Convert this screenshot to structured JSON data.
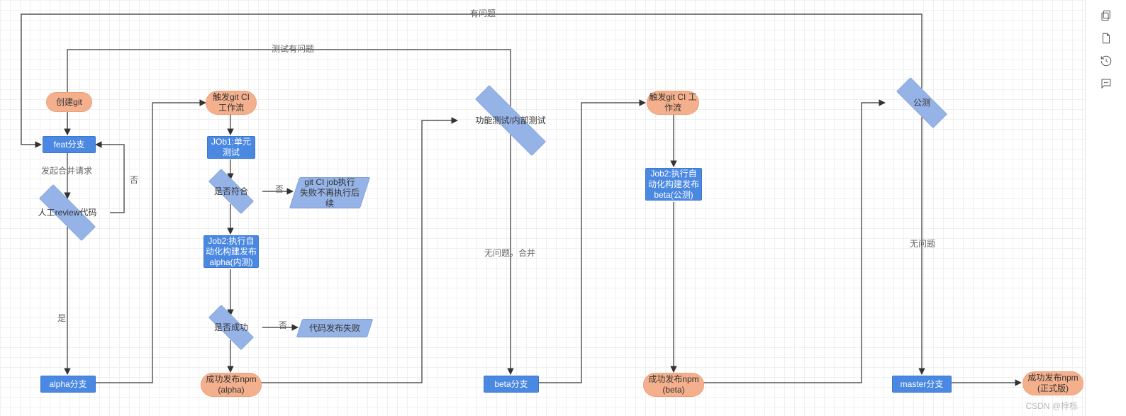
{
  "watermark": "CSDN @桲栎",
  "chart_data": {
    "type": "flowchart",
    "nodes": [
      {
        "id": "n1",
        "shape": "pill",
        "label": "创建git"
      },
      {
        "id": "n2",
        "shape": "rect",
        "label": "feat分支"
      },
      {
        "id": "n3",
        "shape": "diamond",
        "label": "人工review代码"
      },
      {
        "id": "n4",
        "shape": "rect",
        "label": "alpha分支"
      },
      {
        "id": "n5",
        "shape": "pill",
        "label": "触发git CI\n工作流"
      },
      {
        "id": "n6",
        "shape": "rect",
        "label": "JOb1:单元\n测试"
      },
      {
        "id": "n7",
        "shape": "diamond",
        "label": "是否符合"
      },
      {
        "id": "n8",
        "shape": "parallelogram",
        "label": "git CI job执行\n失败不再执行后\n续"
      },
      {
        "id": "n9",
        "shape": "rect",
        "label": "Job2:执行自\n动化构建发布\nalpha(内测)"
      },
      {
        "id": "n10",
        "shape": "diamond",
        "label": "是否成功"
      },
      {
        "id": "n11",
        "shape": "parallelogram",
        "label": "代码发布失败"
      },
      {
        "id": "n12",
        "shape": "pill",
        "label": "成功发布npm\n(alpha)"
      },
      {
        "id": "n13",
        "shape": "diamond",
        "label": "功能测试/内部测试"
      },
      {
        "id": "n14",
        "shape": "rect",
        "label": "beta分支"
      },
      {
        "id": "n15",
        "shape": "pill",
        "label": "触发git CI\n工作流"
      },
      {
        "id": "n16",
        "shape": "rect",
        "label": "Job2:执行自\n动化构建发布\nbeta(公测)"
      },
      {
        "id": "n17",
        "shape": "pill",
        "label": "成功发布npm\n(beta)"
      },
      {
        "id": "n18",
        "shape": "diamond",
        "label": "公测"
      },
      {
        "id": "n19",
        "shape": "rect",
        "label": "master分支"
      },
      {
        "id": "n20",
        "shape": "pill",
        "label": "成功发布npm\n(正式版)"
      }
    ],
    "edges": [
      {
        "from": "n1",
        "to": "n2"
      },
      {
        "from": "n2",
        "to": "n3",
        "label": "发起合并请求"
      },
      {
        "from": "n3",
        "to": "n4",
        "label": "是"
      },
      {
        "from": "n3",
        "to": "n2",
        "label": "否"
      },
      {
        "from": "n4",
        "to": "n5"
      },
      {
        "from": "n5",
        "to": "n6"
      },
      {
        "from": "n6",
        "to": "n7"
      },
      {
        "from": "n7",
        "to": "n8",
        "label": "否"
      },
      {
        "from": "n7",
        "to": "n9"
      },
      {
        "from": "n9",
        "to": "n10"
      },
      {
        "from": "n10",
        "to": "n11",
        "label": "否"
      },
      {
        "from": "n10",
        "to": "n12"
      },
      {
        "from": "n12",
        "to": "n13"
      },
      {
        "from": "n13",
        "to": "n14",
        "label": "无问题，合并"
      },
      {
        "from": "n13",
        "to": "n2",
        "label": "测试有问题"
      },
      {
        "from": "n14",
        "to": "n15"
      },
      {
        "from": "n15",
        "to": "n16"
      },
      {
        "from": "n16",
        "to": "n17"
      },
      {
        "from": "n17",
        "to": "n18"
      },
      {
        "from": "n18",
        "to": "n19",
        "label": "无问题"
      },
      {
        "from": "n18",
        "to": "n2",
        "label": "有问题"
      },
      {
        "from": "n19",
        "to": "n20"
      }
    ]
  },
  "nodes": {
    "n1": "创建git",
    "n2": "feat分支",
    "n3": "人工review代码",
    "n4": "alpha分支",
    "n5": "触发git CI\n工作流",
    "n6": "JOb1:单元\n测试",
    "n7": "是否符合",
    "n8": "git CI job执行\n失败不再执行后\n续",
    "n9": "Job2:执行自\n动化构建发布\nalpha(内测)",
    "n10": "是否成功",
    "n11": "代码发布失败",
    "n12": "成功发布npm\n(alpha)",
    "n13": "功能测试/内部测试",
    "n14": "beta分支",
    "n15": "触发git CI\n工作流",
    "n16": "Job2:执行自\n动化构建发布\nbeta(公测)",
    "n17": "成功发布npm\n(beta)",
    "n18": "公测",
    "n19": "master分支",
    "n20": "成功发布npm\n(正式版)"
  },
  "labels": {
    "e_n2_n3": "发起合并请求",
    "e_n3_n4": "是",
    "e_n3_n2": "否",
    "e_n7_n8": "否",
    "e_n10_n11": "否",
    "e_n13_n14": "无问题，合并",
    "e_n13_n2": "测试有问题",
    "e_n18_n19": "无问题",
    "e_n18_n2": "有问题"
  }
}
